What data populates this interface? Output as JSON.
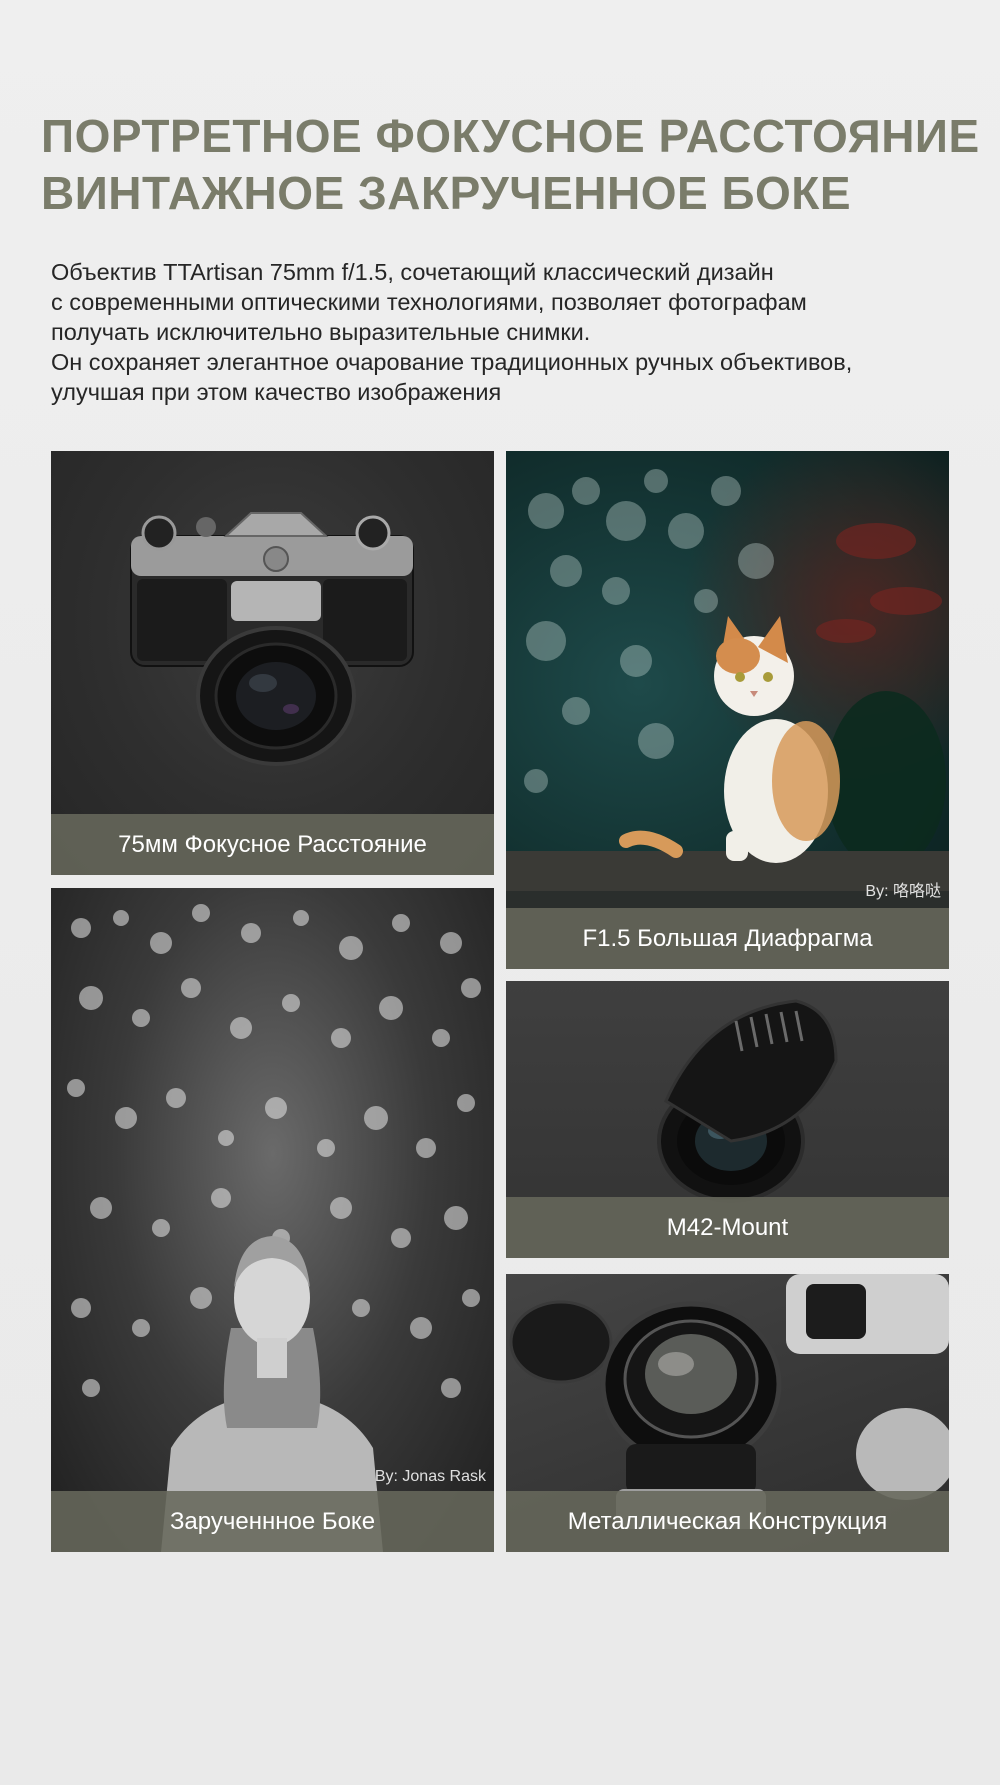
{
  "headline": {
    "line1": "ПОРТРЕТНОЕ ФОКУСНОЕ РАССТОЯНИЕ",
    "line2": "ВИНТАЖНОЕ ЗАКРУЧЕННОЕ БОКЕ"
  },
  "intro": {
    "lines": [
      "Объектив TTArtisan 75mm f/1.5, сочетающий классический дизайн",
      "с современными оптическими технологиями, позволяет фотографам",
      "получать исключительно выразительные снимки.",
      "Он сохраняет элегантное очарование традиционных ручных объективов,",
      "улучшая при этом качество изображения"
    ]
  },
  "cards": {
    "camera": {
      "caption": "75мм Фокусное Расстояние"
    },
    "cat": {
      "caption": "F1.5 Большая Диафрагма",
      "credit": "By:  咯咯哒"
    },
    "portrait": {
      "caption": "Зарученнное Боке",
      "credit": "By:  Jonas Rask"
    },
    "lens": {
      "caption": "M42-Mount"
    },
    "metal": {
      "caption": "Металлическая Конструкция"
    }
  },
  "colors": {
    "headline": "#7a7c6a",
    "caption_bar": "#66685b",
    "background": "#ececec"
  }
}
